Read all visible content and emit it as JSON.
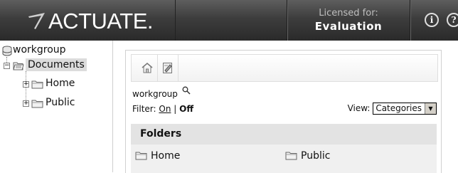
{
  "header": {
    "logo_text": "ACTUATE.",
    "license_label": "Licensed for:",
    "license_value": "Evaluation",
    "info_icon": "info-icon",
    "help_icon": "help-icon"
  },
  "tree": {
    "root_label": "workgroup",
    "documents_label": "Documents",
    "home_label": "Home",
    "public_label": "Public"
  },
  "panel": {
    "path_label": "workgroup",
    "filter_label": "Filter:",
    "filter_on": "On",
    "filter_sep": "|",
    "filter_off": "Off",
    "view_label": "View:",
    "view_value": "Categories",
    "folders_heading": "Folders",
    "folders": [
      "Home",
      "Public"
    ]
  },
  "colors": {
    "header_bg": "#3d3d3d",
    "selected_bg": "#dcdcdc",
    "folders_head_bg": "#e3e3e3"
  }
}
